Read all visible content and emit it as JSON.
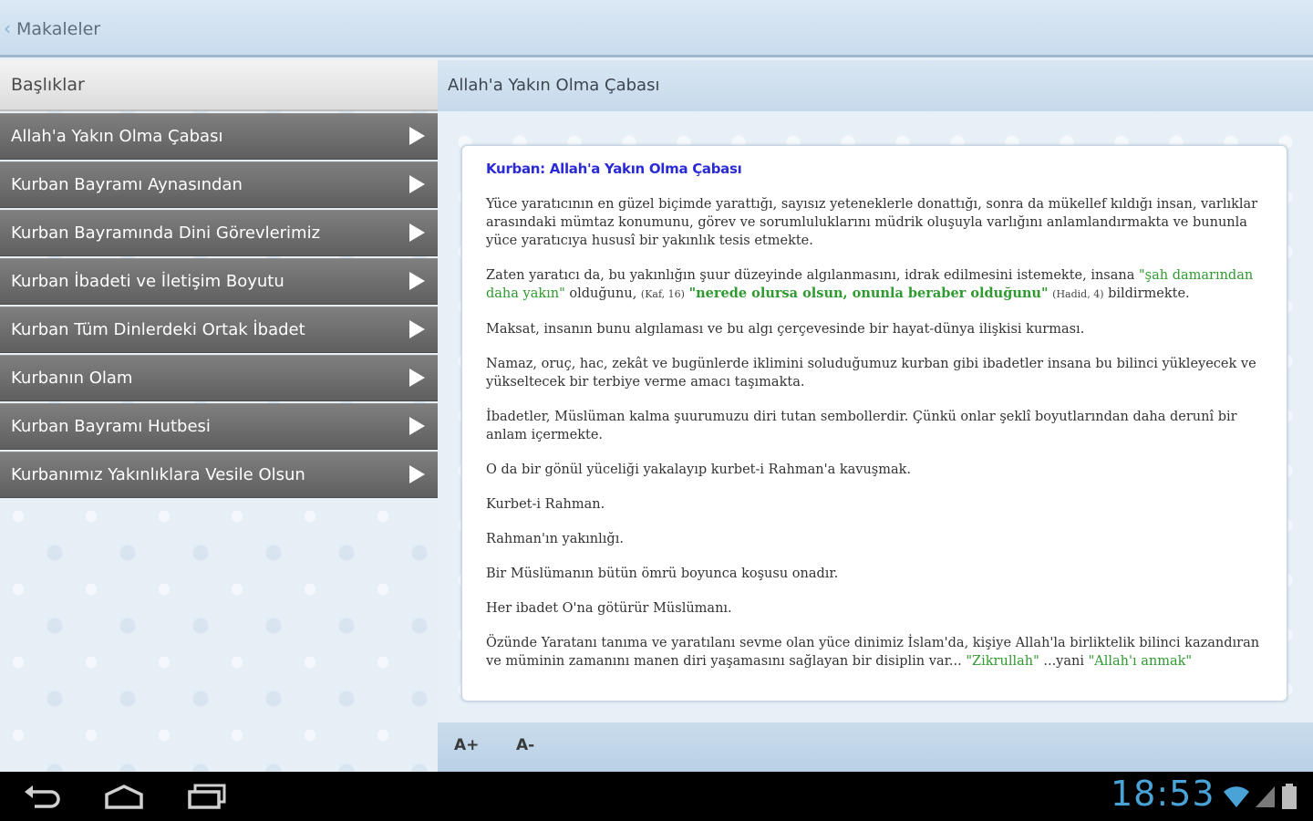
{
  "app": {
    "title": "Makaleler"
  },
  "sidebar": {
    "header": "Başlıklar",
    "items": [
      "Allah'a Yakın Olma Çabası",
      "Kurban Bayramı Aynasından",
      "Kurban Bayramında Dini Görevlerimiz",
      "Kurban İbadeti ve İletişim Boyutu",
      "Kurban Tüm Dinlerdeki Ortak İbadet",
      "Kurbanın Olam",
      "Kurban Bayramı Hutbesi",
      "Kurbanımız Yakınlıklara Vesile Olsun"
    ]
  },
  "article": {
    "header": "Allah'a Yakın Olma Çabası",
    "title": "Kurban: Allah'a Yakın Olma Çabası",
    "p1": "Yüce yaratıcının en güzel biçimde yarattığı, sayısız yeteneklerle donattığı, sonra da mükellef kıldığı insan, varlıklar arasındaki mümtaz konumunu, görev ve sorumluluklarını müdrik oluşuyla varlığını anlamlandırmakta ve bununla yüce yaratıcıya hususî bir yakınlık tesis etmekte.",
    "p2a": "Zaten yaratıcı da, bu yakınlığın şuur düzeyinde algılanmasını, idrak edilmesini istemekte, insana ",
    "p2q1": "\"şah damarından daha yakın\"",
    "p2b": " olduğunu, ",
    "p2r1": "(Kaf, 16)",
    "p2c": " ",
    "p2q2": "\"nerede olursa olsun, onunla beraber olduğunu\"",
    "p2d": " ",
    "p2r2": "(Hadid, 4)",
    "p2e": " bildirmekte.",
    "p3": "Maksat, insanın bunu algılaması ve bu algı çerçevesinde bir hayat-dünya ilişkisi kurması.",
    "p4": "Namaz, oruç, hac, zekât ve bugünlerde iklimini soluduğumuz kurban gibi ibadetler insana bu bilinci yükleyecek ve yükseltecek bir terbiye verme amacı taşımakta.",
    "p5": "İbadetler, Müslüman kalma şuurumuzu diri tutan sembollerdir. Çünkü onlar şeklî boyutlarından daha derunî bir anlam içermekte.",
    "p6": "O da bir gönül yüceliği yakalayıp kurbet-i Rahman'a kavuşmak.",
    "p7": "Kurbet-i Rahman.",
    "p8": "Rahman'ın yakınlığı.",
    "p9": "Bir Müslümanın bütün ömrü boyunca koşusu onadır.",
    "p10": "Her ibadet O'na götürür Müslümanı.",
    "p11a": "Özünde Yaratanı tanıma ve yaratılanı sevme olan yüce dinimiz İslam'da, kişiye Allah'la birliktelik bilinci kazandıran ve müminin zamanını manen diri yaşamasını sağlayan bir disiplin var... ",
    "p11q": "\"Zikrullah\"",
    "p11b": " ...yani ",
    "p11c": "\"Allah'ı anmak\""
  },
  "toolbar": {
    "font_increase": "A+",
    "font_decrease": "A-"
  },
  "status": {
    "time": "18:53"
  },
  "colors": {
    "accent": "#49a3d6",
    "link_title": "#2b2bd6",
    "quote": "#2f9a2f"
  }
}
